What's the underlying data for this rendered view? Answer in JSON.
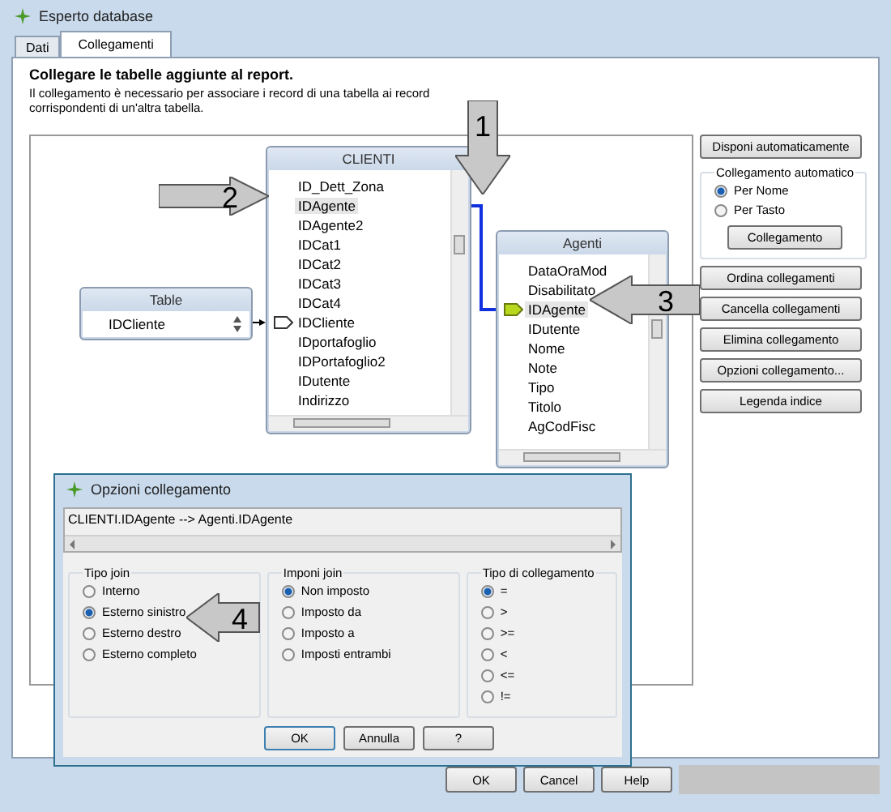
{
  "window": {
    "title": "Esperto database"
  },
  "tabs": [
    {
      "label": "Dati",
      "selected": false
    },
    {
      "label": "Collegamenti",
      "selected": true
    }
  ],
  "heading": "Collegare le tabelle aggiunte al report.",
  "description": "Il collegamento è necessario per associare i record di una tabella ai record corrispondenti di un'altra tabella.",
  "diagram": {
    "tables": [
      {
        "title": "Table",
        "kind": "spin",
        "fields": [
          {
            "name": "IDCliente",
            "selected": false
          }
        ]
      },
      {
        "title": "CLIENTI",
        "kind": "list",
        "fields": [
          {
            "name": "ID_Dett_Zona",
            "selected": false
          },
          {
            "name": "IDAgente",
            "selected": true
          },
          {
            "name": "IDAgente2",
            "selected": false
          },
          {
            "name": "IDCat1",
            "selected": false
          },
          {
            "name": "IDCat2",
            "selected": false
          },
          {
            "name": "IDCat3",
            "selected": false
          },
          {
            "name": "IDCat4",
            "selected": false
          },
          {
            "name": "IDCliente",
            "selected": false,
            "kind": "link-target"
          },
          {
            "name": "IDportafoglio",
            "selected": false
          },
          {
            "name": "IDPortafoglio2",
            "selected": false
          },
          {
            "name": "IDutente",
            "selected": false
          },
          {
            "name": "Indirizzo",
            "selected": false
          }
        ]
      },
      {
        "title": "Agenti",
        "kind": "list",
        "fields": [
          {
            "name": "DataOraMod",
            "selected": false
          },
          {
            "name": "Disabilitato",
            "selected": false
          },
          {
            "name": "IDAgente",
            "selected": true,
            "kind": "link-key"
          },
          {
            "name": "IDutente",
            "selected": false
          },
          {
            "name": "Nome",
            "selected": false
          },
          {
            "name": "Note",
            "selected": false
          },
          {
            "name": "Tipo",
            "selected": false
          },
          {
            "name": "Titolo",
            "selected": false
          },
          {
            "name": "AgCodFisc",
            "selected": false
          }
        ]
      }
    ]
  },
  "callouts": [
    {
      "label": "1"
    },
    {
      "label": "2"
    },
    {
      "label": "3"
    },
    {
      "label": "4"
    }
  ],
  "side_panel": {
    "arrange_button": "Disponi automaticamente",
    "auto_link": {
      "title": "Collegamento automatico",
      "options": [
        {
          "label": "Per Nome",
          "selected": true
        },
        {
          "label": "Per Tasto",
          "selected": false
        }
      ],
      "button": "Collegamento"
    },
    "buttons": [
      "Ordina collegamenti",
      "Cancella collegamenti",
      "Elimina collegamento",
      "Opzioni collegamento...",
      "Legenda indice"
    ]
  },
  "dialog": {
    "title": "Opzioni collegamento",
    "link_text": "CLIENTI.IDAgente --> Agenti.IDAgente",
    "groups": [
      {
        "title": "Tipo join",
        "options": [
          {
            "label": "Interno",
            "selected": false
          },
          {
            "label": "Esterno sinistro",
            "selected": true
          },
          {
            "label": "Esterno destro",
            "selected": false
          },
          {
            "label": "Esterno completo",
            "selected": false
          }
        ]
      },
      {
        "title": "Imponi join",
        "options": [
          {
            "label": "Non imposto",
            "selected": true
          },
          {
            "label": "Imposto da",
            "selected": false
          },
          {
            "label": "Imposto a",
            "selected": false
          },
          {
            "label": "Imposti entrambi",
            "selected": false
          }
        ]
      },
      {
        "title": "Tipo di collegamento",
        "options": [
          {
            "label": "=",
            "selected": true
          },
          {
            "label": ">",
            "selected": false
          },
          {
            "label": ">=",
            "selected": false
          },
          {
            "label": "<",
            "selected": false
          },
          {
            "label": "<=",
            "selected": false
          },
          {
            "label": "!=",
            "selected": false
          }
        ]
      }
    ],
    "buttons": [
      "OK",
      "Annulla",
      "?"
    ]
  },
  "footer_buttons": [
    "OK",
    "Cancel",
    "Help"
  ]
}
